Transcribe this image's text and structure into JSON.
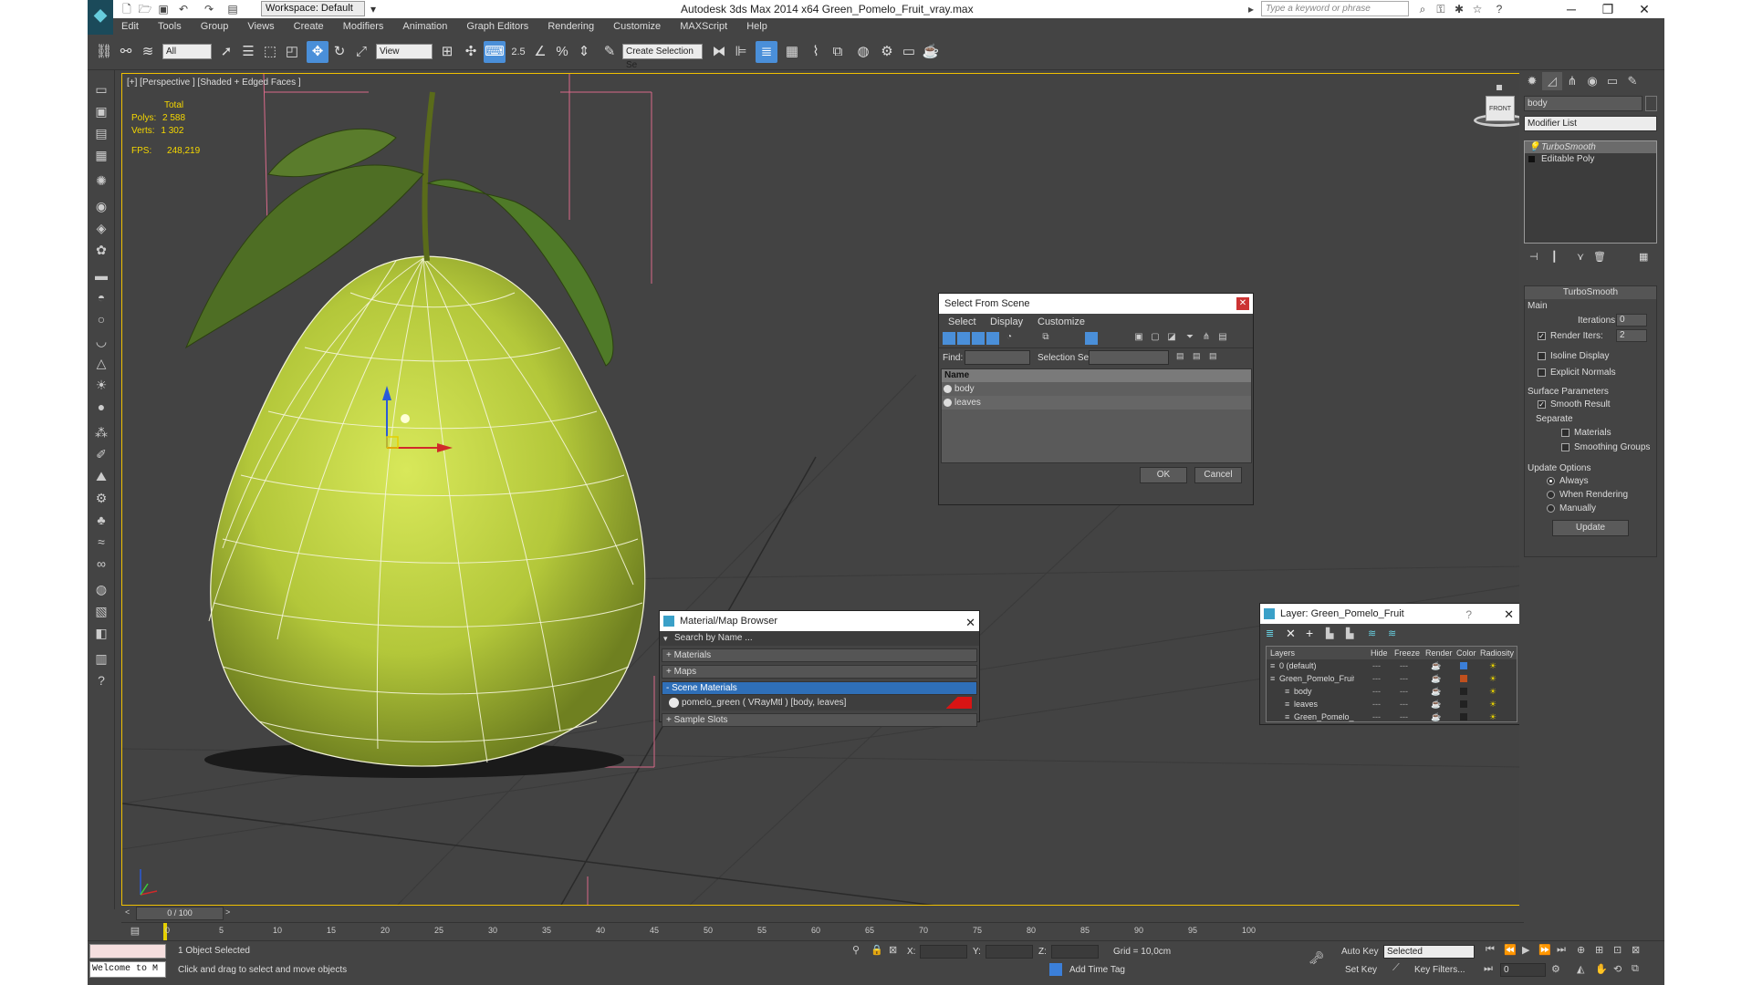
{
  "window": {
    "title": "Autodesk 3ds Max  2014 x64     Green_Pomelo_Fruit_vray.max",
    "workspace": "Workspace: Default",
    "search_placeholder": "Type a keyword or phrase"
  },
  "menu": [
    "Edit",
    "Tools",
    "Group",
    "Views",
    "Create",
    "Modifiers",
    "Animation",
    "Graph Editors",
    "Rendering",
    "Customize",
    "MAXScript",
    "Help"
  ],
  "toolbar": {
    "filter": "All",
    "ref_coord": "View",
    "snap_label": "2.5",
    "selection_set": "Create Selection Se"
  },
  "viewport": {
    "label": "[+] [Perspective ] [Shaded + Edged Faces ]",
    "stats_header": "Total",
    "polys_label": "Polys:",
    "polys": "2 588",
    "verts_label": "Verts:",
    "verts": "1 302",
    "fps_label": "FPS:",
    "fps": "248,219",
    "viewcube": "FRONT"
  },
  "command_panel": {
    "object_name": "body",
    "modifier_list": "Modifier List",
    "stack": [
      "TurboSmooth",
      "Editable Poly"
    ],
    "turbosmooth": {
      "title": "TurboSmooth",
      "main": "Main",
      "iterations_label": "Iterations:",
      "iterations": "0",
      "render_iters_label": "Render Iters:",
      "render_iters": "2",
      "isoline": "Isoline Display",
      "explicit": "Explicit Normals",
      "surface": "Surface Parameters",
      "smooth_result": "Smooth Result",
      "separate": "Separate",
      "materials": "Materials",
      "smoothing_groups": "Smoothing Groups",
      "update_options": "Update Options",
      "always": "Always",
      "when_rendering": "When Rendering",
      "manually": "Manually",
      "update": "Update"
    }
  },
  "select_dialog": {
    "title": "Select From Scene",
    "menu": [
      "Select",
      "Display",
      "Customize"
    ],
    "find_label": "Find:",
    "selset_label": "Selection Set:",
    "col_name": "Name",
    "items": [
      "body",
      "leaves"
    ],
    "ok": "OK",
    "cancel": "Cancel"
  },
  "material_browser": {
    "title": "Material/Map Browser",
    "search": "Search by Name ...",
    "sections": [
      "+ Materials",
      "+ Maps",
      "- Scene Materials"
    ],
    "material": "pomelo_green  ( VRayMtl ) [body, leaves]",
    "sample_slots": "+ Sample Slots"
  },
  "layer_dialog": {
    "title": "Layer: Green_Pomelo_Fruit",
    "cols": [
      "Layers",
      "Hide",
      "Freeze",
      "Render",
      "Color",
      "Radiosity"
    ],
    "rows": [
      {
        "name": "0 (default)",
        "color": "#3b7fd9"
      },
      {
        "name": "Green_Pomelo_Fruit",
        "color": "#c0501e"
      },
      {
        "name": "body",
        "color": "#222222"
      },
      {
        "name": "leaves",
        "color": "#222222"
      },
      {
        "name": "Green_Pomelo_F",
        "color": "#222222"
      }
    ]
  },
  "timeline": {
    "frame": "0 / 100",
    "ticks": [
      "0",
      "5",
      "10",
      "15",
      "20",
      "25",
      "30",
      "35",
      "40",
      "45",
      "50",
      "55",
      "60",
      "65",
      "70",
      "75",
      "80",
      "85",
      "90",
      "95",
      "100"
    ]
  },
  "status": {
    "listener": "Welcome to M",
    "selected": "1 Object Selected",
    "prompt": "Click and drag to select and move objects",
    "x_label": "X:",
    "y_label": "Y:",
    "z_label": "Z:",
    "grid": "Grid = 10,0cm",
    "auto_key": "Auto Key",
    "set_key": "Set Key",
    "selected_dropdown": "Selected",
    "key_filters": "Key Filters...",
    "add_time_tag": "Add Time Tag",
    "frame": "0"
  }
}
